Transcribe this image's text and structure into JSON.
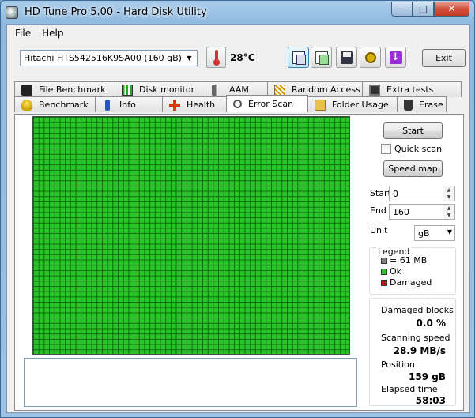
{
  "window": {
    "title": "HD Tune Pro 5.00 - Hard Disk Utility"
  },
  "menu": {
    "file": "File",
    "help": "Help"
  },
  "toolbar": {
    "drive": "Hitachi HTS542516K9SA00 (160 gB)",
    "temperature": "28°C",
    "exit_label": "Exit"
  },
  "tabs_top": [
    "File Benchmark",
    "Disk monitor",
    "AAM",
    "Random Access",
    "Extra tests"
  ],
  "tabs_bottom": [
    "Benchmark",
    "Info",
    "Health",
    "Error Scan",
    "Folder Usage",
    "Erase"
  ],
  "active_tab": "Error Scan",
  "scan": {
    "start_label": "Start",
    "quick_scan_label": "Quick scan",
    "quick_scan_checked": false,
    "speed_map_label": "Speed map",
    "start_field_label": "Start",
    "start_value": "0",
    "end_field_label": "End",
    "end_value": "160",
    "unit_label": "Unit",
    "unit_value": "gB"
  },
  "legend": {
    "title": "Legend",
    "block": "= 61 MB",
    "ok": "Ok",
    "damaged": "Damaged",
    "colors": {
      "block": "#808080",
      "ok": "#27c727",
      "damaged": "#d01010"
    }
  },
  "stats": {
    "damaged_blocks_label": "Damaged blocks",
    "damaged_blocks_value": "0.0 %",
    "scanning_speed_label": "Scanning speed",
    "scanning_speed_value": "28.9 MB/s",
    "position_label": "Position",
    "position_value": "159 gB",
    "elapsed_label": "Elapsed time",
    "elapsed_value": "58:03"
  }
}
